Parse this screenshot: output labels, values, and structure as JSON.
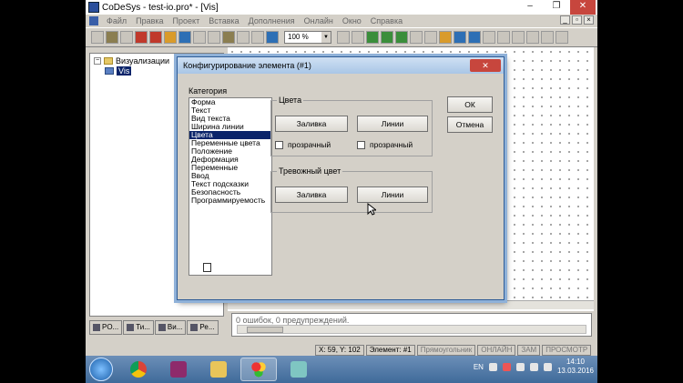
{
  "window": {
    "title": "CoDeSys - test-io.pro* - [Vis]",
    "buttons": {
      "minimize": "–",
      "maximize": "❐",
      "close": "✕"
    }
  },
  "menu": {
    "items": [
      "Файл",
      "Правка",
      "Проект",
      "Вставка",
      "Дополнения",
      "Онлайн",
      "Окно",
      "Справка"
    ],
    "mdi": {
      "minimize": "_",
      "restore": "▫",
      "close": "×"
    }
  },
  "toolbar": {
    "zoom_value": "100 %"
  },
  "tree": {
    "root_label": "Визуализации",
    "child_label": "Vis",
    "expand_glyph": "−"
  },
  "tree_tabs": [
    "PO...",
    "Ти...",
    "Ви...",
    "Ре..."
  ],
  "messages": {
    "text": "0 ошибок, 0 предупреждений."
  },
  "status": {
    "x_label": "X:",
    "x_value": "59",
    "y_label": "Y:",
    "y_value": "102",
    "element_label": "Элемент: #1",
    "mode": "Прямоугольник",
    "online": "ОНЛАЙН",
    "zam": "ЗАМ",
    "view": "ПРОСМОТР"
  },
  "taskbar": {
    "language": "EN",
    "time": "14:10",
    "date": "13.03.2016"
  },
  "dialog": {
    "title": "Конфигурирование элемента (#1)",
    "close_glyph": "✕",
    "category_label": "Категория",
    "categories": [
      "Форма",
      "Текст",
      "Вид текста",
      "Ширина линии",
      "Цвета",
      "Переменные цвета",
      "Положение",
      "Деформация",
      "Переменные",
      "Ввод",
      "Текст подсказки",
      "Безопасность",
      "Программируемость"
    ],
    "selected_category": "Цвета",
    "colors_group": {
      "label": "Цвета",
      "fill_button": "Заливка",
      "lines_button": "Линии",
      "transparent_left": "прозрачный",
      "transparent_right": "прозрачный"
    },
    "alarm_group": {
      "label": "Тревожный цвет",
      "fill_button": "Заливка",
      "lines_button": "Линии"
    },
    "ok_button": "ОК",
    "cancel_button": "Отмена"
  }
}
